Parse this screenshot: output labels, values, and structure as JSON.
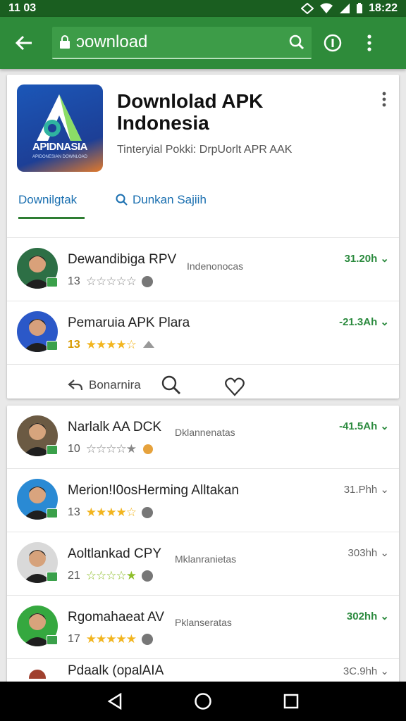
{
  "status_bar": {
    "left": "11 03",
    "time": "18:22"
  },
  "app_bar": {
    "url_text": "ɔownload"
  },
  "app": {
    "title_line1": "Downlolad APK",
    "title_line2": "Indonesia",
    "subtitle": "Tinteryial Pokki: DrpUorlt APR AAK",
    "logo_text": "APIDNASIA",
    "logo_sub": "APIDONESIAN DOWNLOAD"
  },
  "tabs": {
    "download": "Downilgtak",
    "search": "Dunkan Sajiih"
  },
  "list": [
    {
      "title": "Dewandibiga RPV",
      "tag": "Indenonocas",
      "size": "31.20h ⌄",
      "count": "13",
      "stars": "☆☆☆☆☆",
      "star_color": "#888888"
    },
    {
      "title": "Pemaruia APK Plara",
      "tag": "",
      "size": "-21.3Ah ⌄",
      "count": "13",
      "stars": "★★★★☆",
      "star_color": "#f2b51f"
    }
  ],
  "actions": {
    "more_label": "Bonarnira"
  },
  "list2": [
    {
      "title": "Narlalk AA DCK",
      "tag": "Dklannenatas",
      "size": "-41.5Ah ⌄",
      "count": "10",
      "stars": "☆☆☆☆★",
      "star_color": "#888888"
    },
    {
      "title": "Merion!I0osHerming Alltakan",
      "tag": "",
      "size": "31.Phh ⌄",
      "count": "13",
      "stars": "★★★★☆",
      "star_color": "#f2b51f"
    },
    {
      "title": "Aoltlankad CPY",
      "tag": "Mklanranietas",
      "size": "303hh ⌄",
      "count": "21",
      "stars": "☆☆☆☆★",
      "star_color": "#8fbf2b"
    },
    {
      "title": "Rgomahaeat AV",
      "tag": "Pklanseratas",
      "size": "302hh ⌄",
      "count": "17",
      "stars": "★★★★★",
      "star_color": "#f2b51f"
    }
  ],
  "partial_row": {
    "title": "Pdaalk (opalAIA",
    "size": "3C.9hh ⌄"
  },
  "colors": {
    "app_bar": "#2e8b3a",
    "accent_green": "#2b8a3e",
    "tab_blue": "#1a6fb0",
    "star_gold": "#f2b51f"
  },
  "icons": [
    "back-arrow-icon",
    "lock-icon",
    "search-icon",
    "info-icon",
    "more-vert-icon",
    "share-icon",
    "heart-icon",
    "nav-back-icon",
    "nav-home-icon",
    "nav-recent-icon"
  ]
}
